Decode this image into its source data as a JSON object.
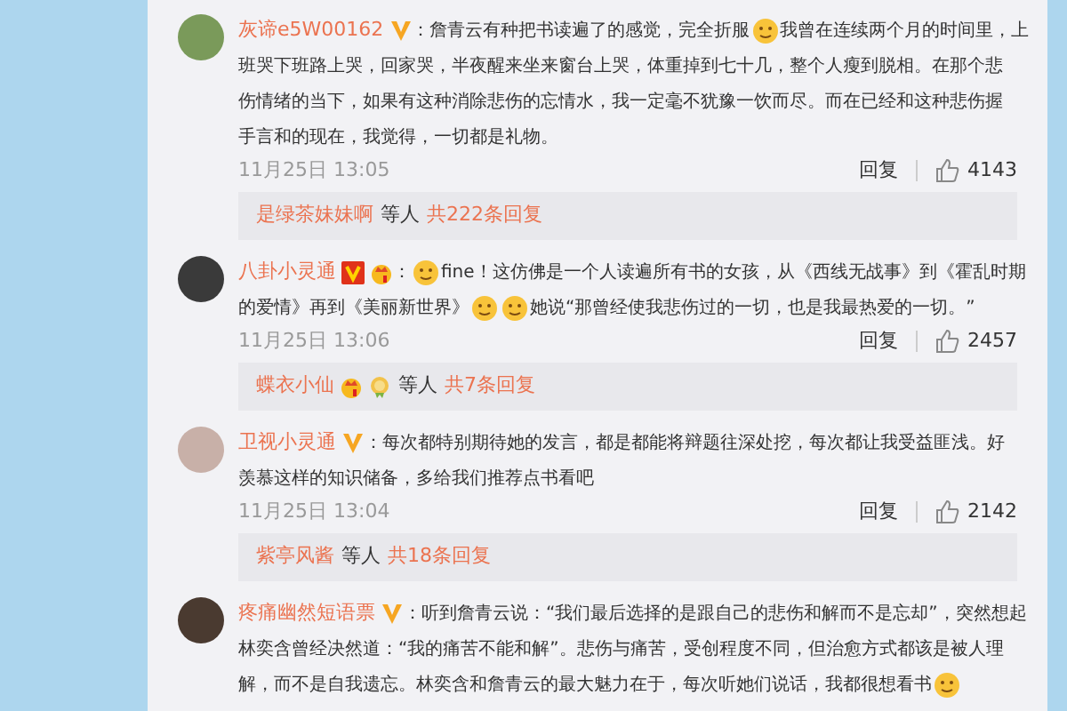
{
  "comments": [
    {
      "user": "灰谛e5W00162",
      "badges": [
        {
          "kind": "verified"
        }
      ],
      "lines": [
        [
          {
            "kind": "text",
            "text": "：詹青云有种把书读遍了的感觉，完全折服"
          },
          {
            "kind": "emoji"
          },
          {
            "kind": "text",
            "text": "我曾在连续两个月的时间里，上"
          }
        ],
        [
          {
            "kind": "text",
            "text": "班哭下班路上哭，回家哭，半夜醒来坐来窗台上哭，体重掉到七十几，整个人瘦到脱相。在那个悲"
          }
        ],
        [
          {
            "kind": "text",
            "text": "伤情绪的当下，如果有这种消除悲伤的忘情水，我一定毫不犹豫一饮而尽。而在已经和这种悲伤握"
          }
        ],
        [
          {
            "kind": "text",
            "text": "手言和的现在，我觉得，一切都是礼物。"
          }
        ]
      ],
      "time": "11月25日 13:05",
      "reply": "回复",
      "likes": "4143",
      "thread": {
        "names": [
          {
            "name": "是绿茶妹妹啊"
          }
        ],
        "etc": "等人",
        "count": "共222条回复"
      }
    },
    {
      "user": "八卦小灵通",
      "badges": [
        {
          "kind": "vip"
        },
        {
          "kind": "crown"
        }
      ],
      "lines": [
        [
          {
            "kind": "text",
            "text": "："
          },
          {
            "kind": "emoji"
          },
          {
            "kind": "text",
            "text": "fine！这仿佛是一个人读遍所有书的女孩，从《西线无战事》到《霍乱时期"
          }
        ],
        [
          {
            "kind": "text",
            "text": "的爱情》再到《美丽新世界》"
          },
          {
            "kind": "emoji"
          },
          {
            "kind": "emoji"
          },
          {
            "kind": "text",
            "text": "她说“那曾经使我悲伤过的一切，也是我最热爱的一切。”"
          }
        ]
      ],
      "time": "11月25日 13:06",
      "reply": "回复",
      "likes": "2457",
      "thread": {
        "names": [
          {
            "name": "蝶衣小仙",
            "badges": [
              {
                "kind": "crown"
              },
              {
                "kind": "medal"
              }
            ]
          }
        ],
        "etc": "等人",
        "count": "共7条回复"
      }
    },
    {
      "user": "卫视小灵通",
      "badges": [
        {
          "kind": "verified"
        }
      ],
      "lines": [
        [
          {
            "kind": "text",
            "text": "：每次都特别期待她的发言，都是都能将辩题往深处挖，每次都让我受益匪浅。好"
          }
        ],
        [
          {
            "kind": "text",
            "text": "羡慕这样的知识储备，多给我们推荐点书看吧"
          }
        ]
      ],
      "time": "11月25日 13:04",
      "reply": "回复",
      "likes": "2142",
      "thread": {
        "names": [
          {
            "name": "紫亭风酱"
          }
        ],
        "etc": "等人",
        "count": "共18条回复"
      }
    },
    {
      "user": "疼痛幽然短语票",
      "badges": [
        {
          "kind": "verified"
        }
      ],
      "lines": [
        [
          {
            "kind": "text",
            "text": "：听到詹青云说：“我们最后选择的是跟自己的悲伤和解而不是忘却”，突然想起"
          }
        ],
        [
          {
            "kind": "text",
            "text": "林奕含曾经决然道：“我的痛苦不能和解”。悲伤与痛苦，受创程度不同，但治愈方式都该是被人理"
          }
        ],
        [
          {
            "kind": "text",
            "text": "解，而不是自我遗忘。林奕含和詹青云的最大魅力在于，每次听她们说话，我都很想看书"
          },
          {
            "kind": "emoji"
          }
        ]
      ]
    }
  ]
}
